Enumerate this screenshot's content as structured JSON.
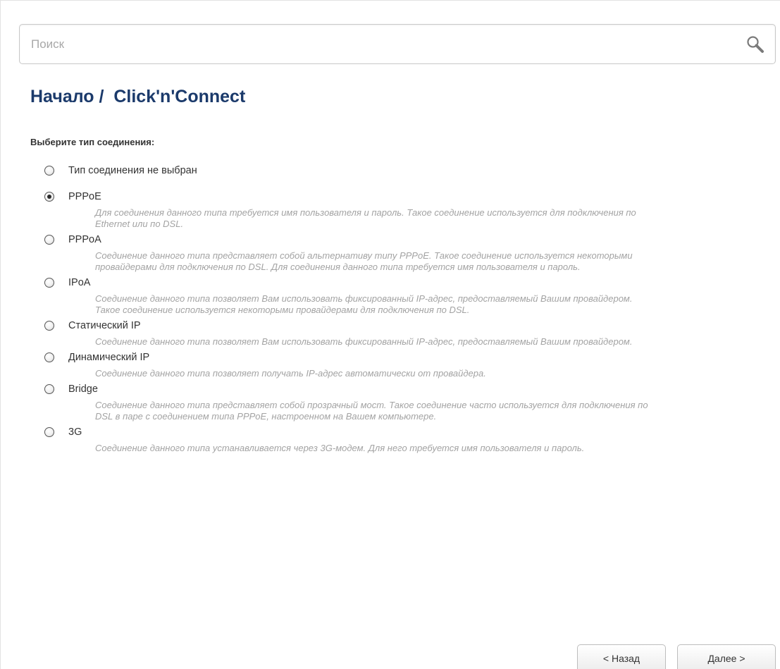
{
  "search": {
    "placeholder": "Поиск"
  },
  "breadcrumb": {
    "title": "Начало /  Click'n'Connect"
  },
  "form": {
    "prompt": "Выберите тип соединения:",
    "selected": "pppoe",
    "options": [
      {
        "id": "none",
        "label": "Тип соединения не выбран",
        "description": ""
      },
      {
        "id": "pppoe",
        "label": "PPPoE",
        "description": "Для соединения данного типа требуется имя пользователя и пароль. Такое соединение используется для подключения по Ethernet или по DSL."
      },
      {
        "id": "pppoa",
        "label": "PPPoA",
        "description": "Соединение данного типа представляет собой альтернативу типу PPPoE. Такое соединение используется некоторыми провайдерами для подключения по DSL. Для соединения данного типа требуется имя пользователя и пароль."
      },
      {
        "id": "ipoa",
        "label": "IPoA",
        "description": "Соединение данного типа позволяет Вам использовать фиксированный IP-адрес, предоставляемый Вашим провайдером. Такое соединение используется некоторыми провайдерами для подключения по DSL."
      },
      {
        "id": "static-ip",
        "label": "Статический IP",
        "description": "Соединение данного типа позволяет Вам использовать фиксированный IP-адрес, предоставляемый Вашим провайдером."
      },
      {
        "id": "dynamic-ip",
        "label": "Динамический IP",
        "description": "Соединение данного типа позволяет получать IP-адрес автоматически от провайдера."
      },
      {
        "id": "bridge",
        "label": "Bridge",
        "description": "Соединение данного типа представляет собой прозрачный мост. Такое соединение часто используется для подключения по DSL в паре с соединением типа PPPoE, настроенном на Вашем компьютере."
      },
      {
        "id": "3g",
        "label": "3G",
        "description": "Соединение данного типа устанавливается через 3G-модем. Для него требуется имя пользователя и пароль."
      }
    ]
  },
  "buttons": {
    "back_label": "< Назад",
    "next_label": "Далее >"
  },
  "colors": {
    "title": "#1b3a6b",
    "description_text": "#a3a3a3"
  },
  "icons": {
    "search": "magnifier-icon"
  }
}
